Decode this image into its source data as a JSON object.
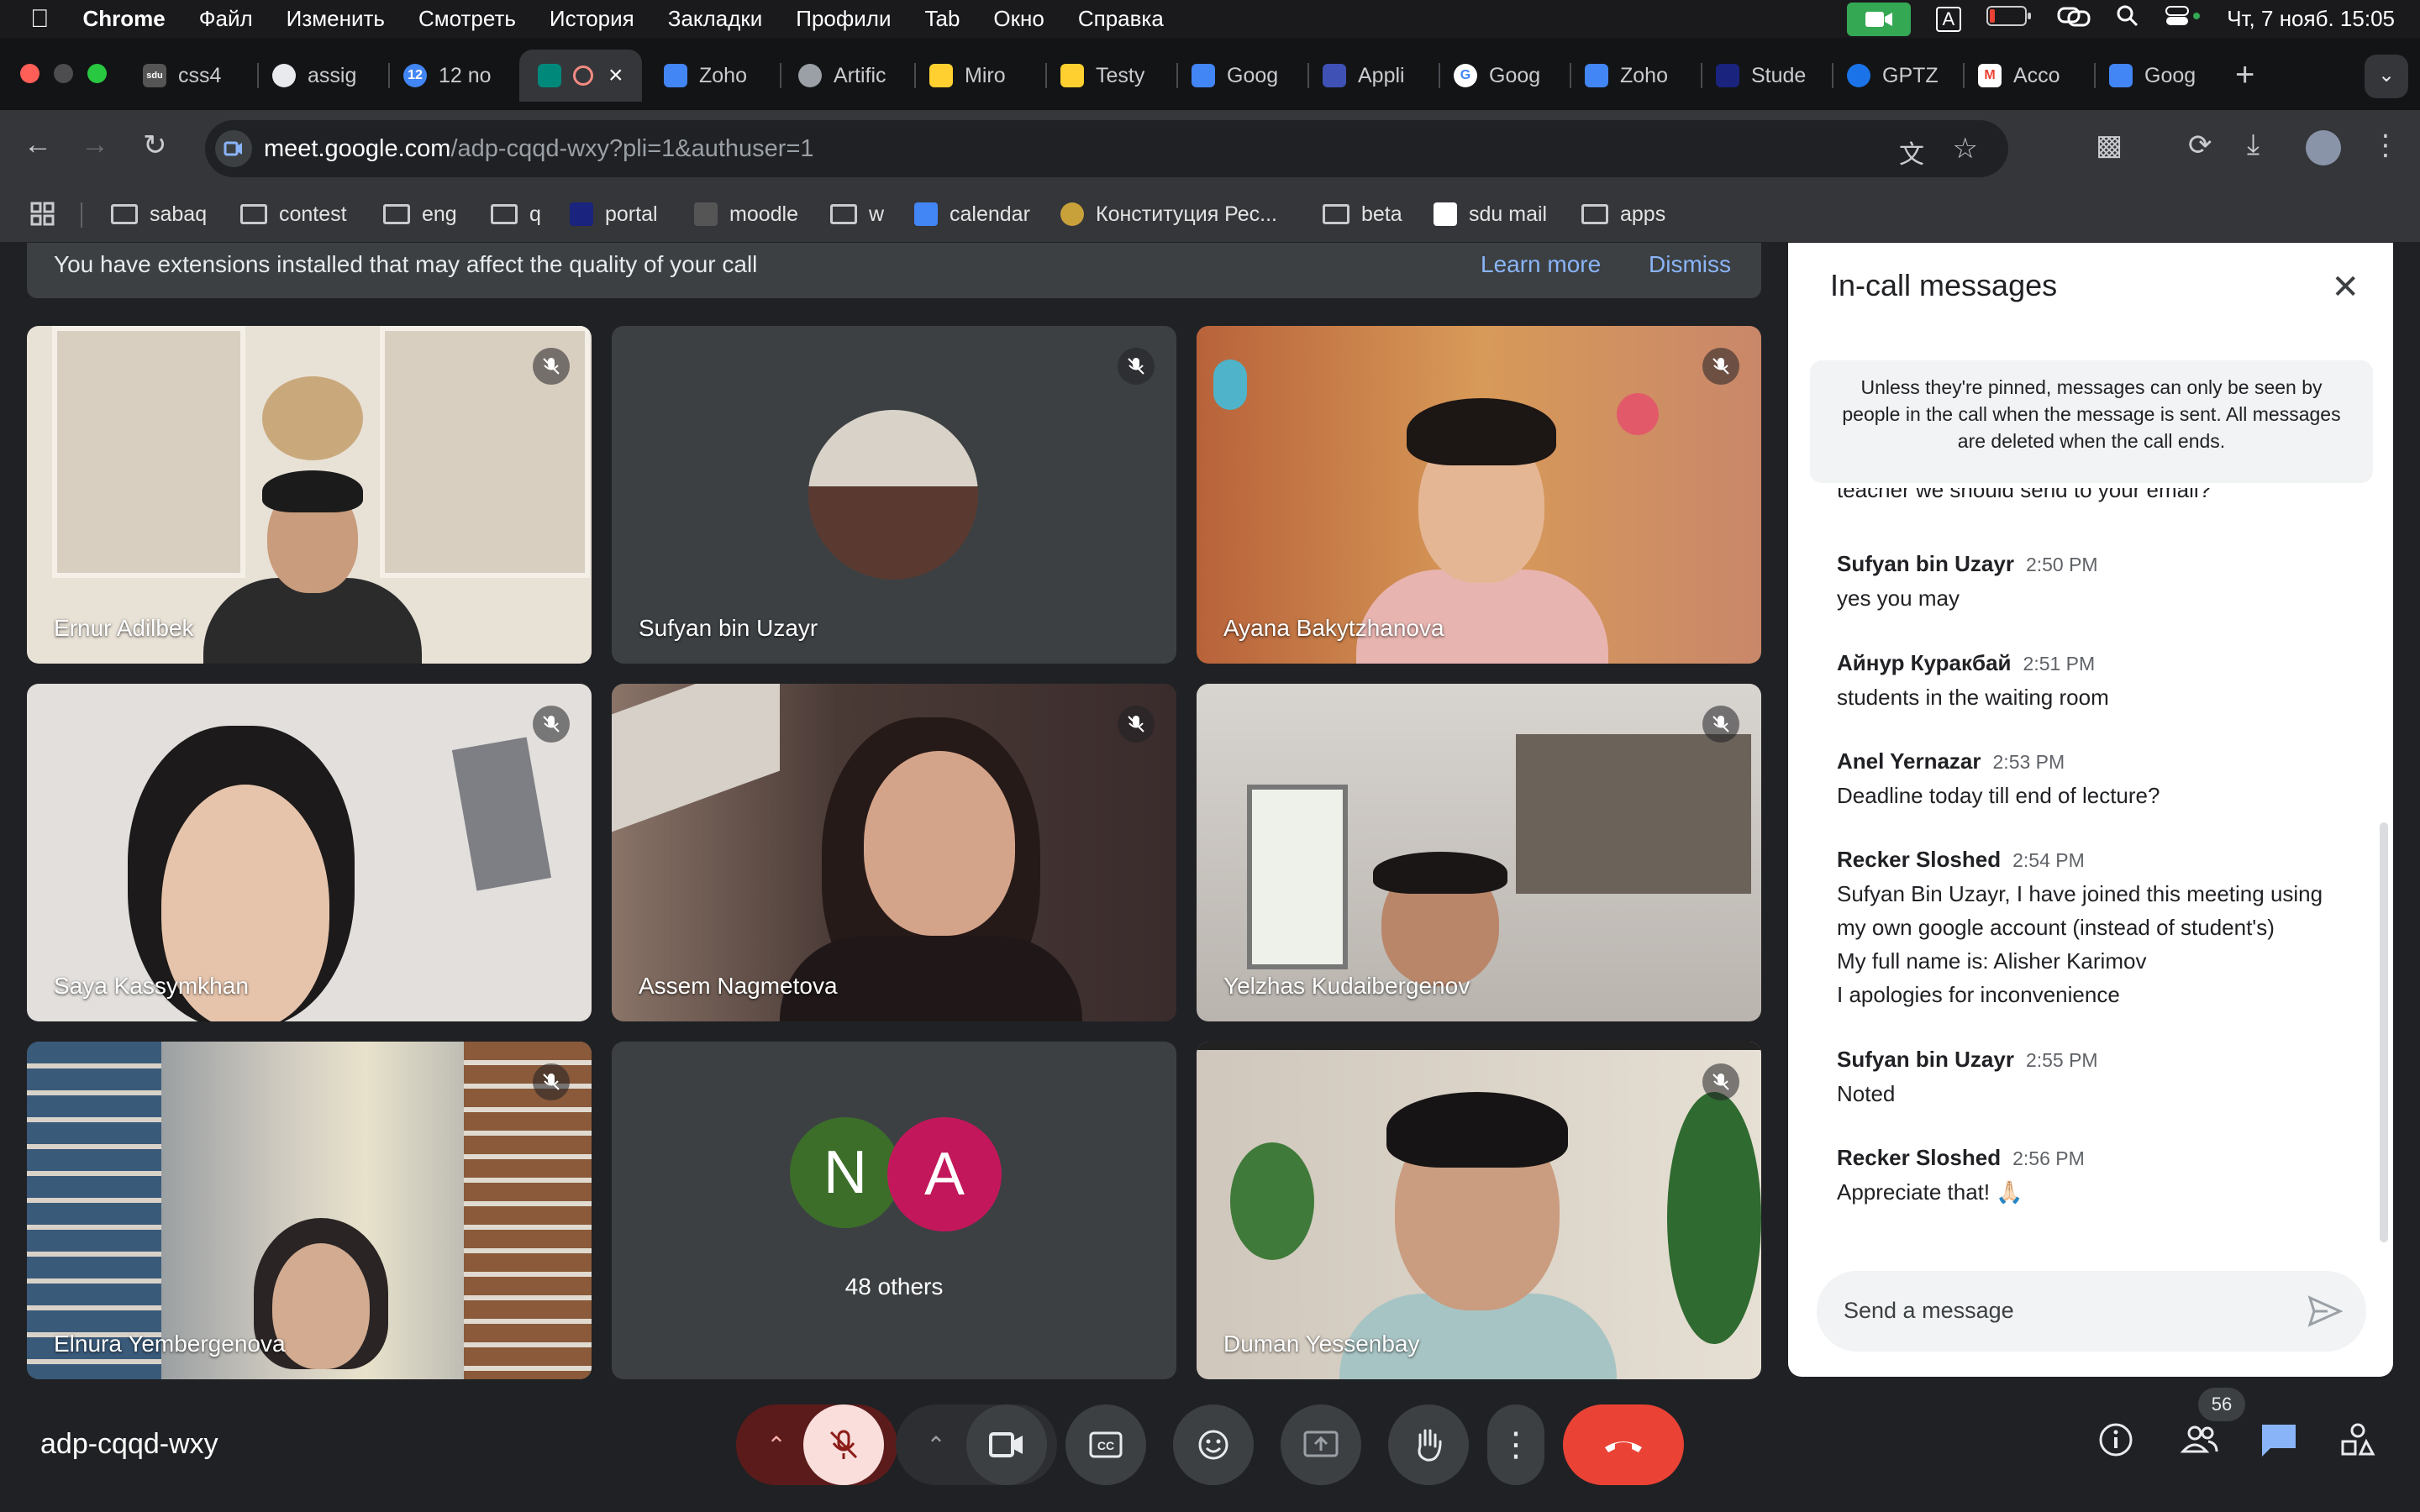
{
  "menubar": {
    "app": "Chrome",
    "items": [
      "Файл",
      "Изменить",
      "Смотреть",
      "История",
      "Закладки",
      "Профили",
      "Tab",
      "Окно",
      "Справка"
    ],
    "input_badge": "A",
    "clock": "Чт, 7 нояб.  15:05"
  },
  "tabs": [
    {
      "label": "css4"
    },
    {
      "label": "assig"
    },
    {
      "label": "12 no"
    },
    {
      "label": ""
    },
    {
      "label": "Zoho"
    },
    {
      "label": "Artific"
    },
    {
      "label": "Miro"
    },
    {
      "label": "Testy"
    },
    {
      "label": "Goog"
    },
    {
      "label": "Appli"
    },
    {
      "label": "Goog"
    },
    {
      "label": "Zoho"
    },
    {
      "label": "Stude"
    },
    {
      "label": "GPTZ"
    },
    {
      "label": "Acco"
    },
    {
      "label": "Goog"
    }
  ],
  "omnibox": {
    "host": "meet.google.com",
    "path": "/adp-cqqd-wxy?pli=1&authuser=1"
  },
  "bookmarks": [
    "sabaq",
    "contest",
    "eng",
    "q",
    "portal",
    "moodle",
    "w",
    "calendar",
    "Конституция Рес...",
    "beta",
    "sdu mail",
    "apps"
  ],
  "banner": {
    "message": "You have extensions installed that may affect the quality of your call",
    "learn_more": "Learn more",
    "dismiss": "Dismiss"
  },
  "participants": [
    {
      "name": "Ernur Adilbek"
    },
    {
      "name": "Sufyan bin Uzayr"
    },
    {
      "name": "Ayana Bakytzhanova"
    },
    {
      "name": "Saya Kassymkhan"
    },
    {
      "name": "Assem Nagmetova"
    },
    {
      "name": "Yelzhas Kudaibergenov"
    },
    {
      "name": "Elnura Yembergenova"
    },
    {
      "name": "48 others",
      "initials": [
        "N",
        "A"
      ]
    },
    {
      "name": "Duman Yessenbay"
    }
  ],
  "chat": {
    "title": "In-call messages",
    "notice": "Unless they're pinned, messages can only be seen by people in the call when the message is sent. All messages are deleted when the call ends.",
    "partial_line": "teacher we should send to your email?",
    "messages": [
      {
        "sender": "Sufyan bin Uzayr",
        "time": "2:50 PM",
        "lines": [
          "yes you may"
        ]
      },
      {
        "sender": "Айнур Куракбай",
        "time": "2:51 PM",
        "lines": [
          "students in the waiting room"
        ]
      },
      {
        "sender": "Anel Yernazar",
        "time": "2:53 PM",
        "lines": [
          "Deadline today till end of lecture?"
        ]
      },
      {
        "sender": "Recker Sloshed",
        "time": "2:54 PM",
        "lines": [
          "Sufyan Bin Uzayr, I have joined this meeting using",
          "my own google account (instead of student's)",
          "My full name is: Alisher Karimov",
          "I apologies for inconvenience"
        ]
      },
      {
        "sender": "Sufyan bin Uzayr",
        "time": "2:55 PM",
        "lines": [
          "Noted"
        ]
      },
      {
        "sender": "Recker Sloshed",
        "time": "2:56 PM",
        "lines": [
          "Appreciate that! 🙏🏻"
        ]
      }
    ],
    "input_placeholder": "Send a message"
  },
  "bottom": {
    "meeting_code": "adp-cqqd-wxy",
    "people_count": "56"
  },
  "colors": {
    "meet_bg": "#202124",
    "tile_bg": "#3c4043",
    "end_call": "#ea4335",
    "link": "#8ab4f8",
    "avatar_n": "#3c6e2a",
    "avatar_a": "#c2185b"
  }
}
